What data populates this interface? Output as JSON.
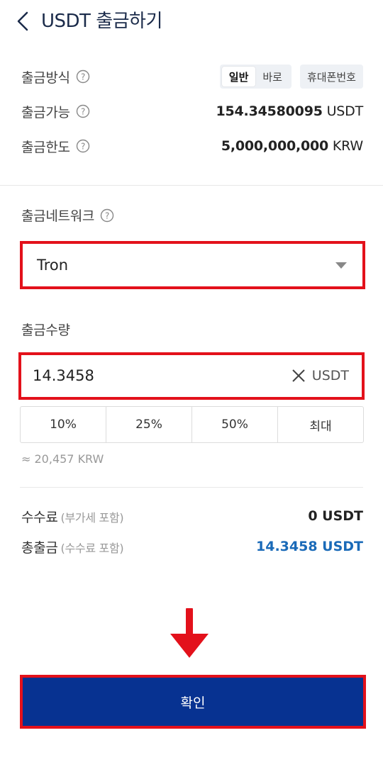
{
  "header": {
    "title": "USDT 출금하기",
    "back_icon": "chevron-left-icon"
  },
  "info": {
    "method_label": "출금방식",
    "method_options": [
      "일반",
      "바로"
    ],
    "method_selected": "일반",
    "phone_label": "휴대폰번호",
    "available_label": "출금가능",
    "available_amount": "154.34580095",
    "available_unit": "USDT",
    "limit_label": "출금한도",
    "limit_amount": "5,000,000,000",
    "limit_unit": "KRW"
  },
  "network": {
    "label": "출금네트워크",
    "selected": "Tron",
    "highlight_color": "#e3111b"
  },
  "amount": {
    "label": "출금수량",
    "value": "14.3458",
    "unit": "USDT",
    "quick_buttons": [
      "10%",
      "25%",
      "50%",
      "최대"
    ],
    "approx_krw": "≈ 20,457 KRW"
  },
  "summary": {
    "fee_label": "수수료",
    "fee_note": "(부가세 포함)",
    "fee_value": "0 USDT",
    "total_label": "총출금",
    "total_note": "(수수료 포함)",
    "total_value": "14.3458 USDT",
    "total_color": "#1a6ab8"
  },
  "confirm": {
    "label": "확인",
    "bg_color": "#073291"
  }
}
